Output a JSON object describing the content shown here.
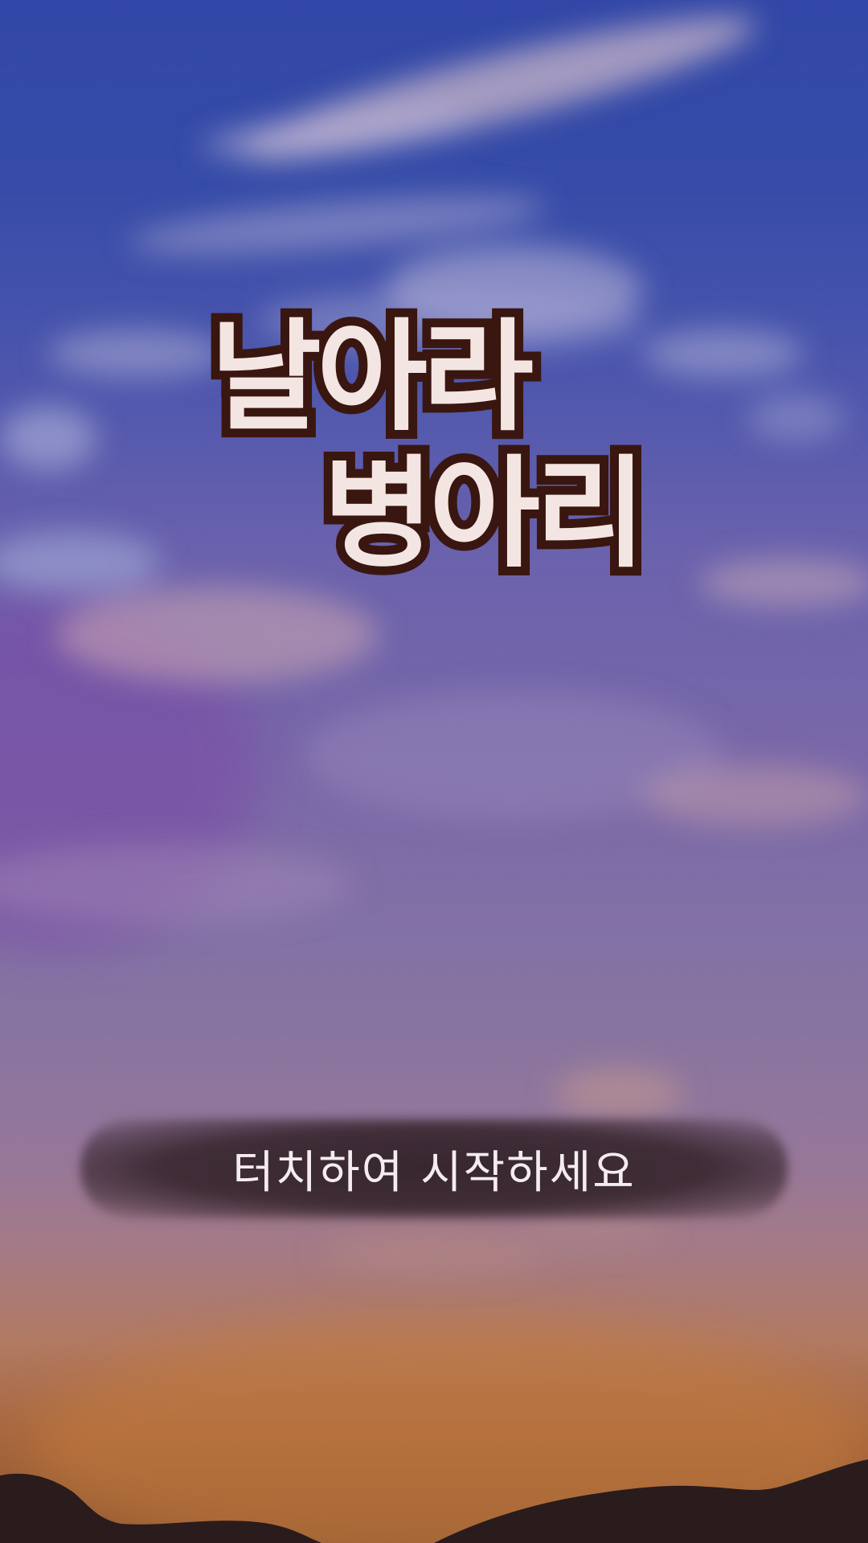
{
  "title": {
    "line1": "날아라",
    "line2": "병아리"
  },
  "start_prompt": {
    "label": "터치하여 시작하세요"
  },
  "colors": {
    "sky_top": "#3247a7",
    "sky_mid": "#7a68a8",
    "sunset": "#b27a63",
    "ground": "#2a1a1a",
    "title_fill": "#f3e6e2",
    "title_outline": "#3a1610"
  }
}
